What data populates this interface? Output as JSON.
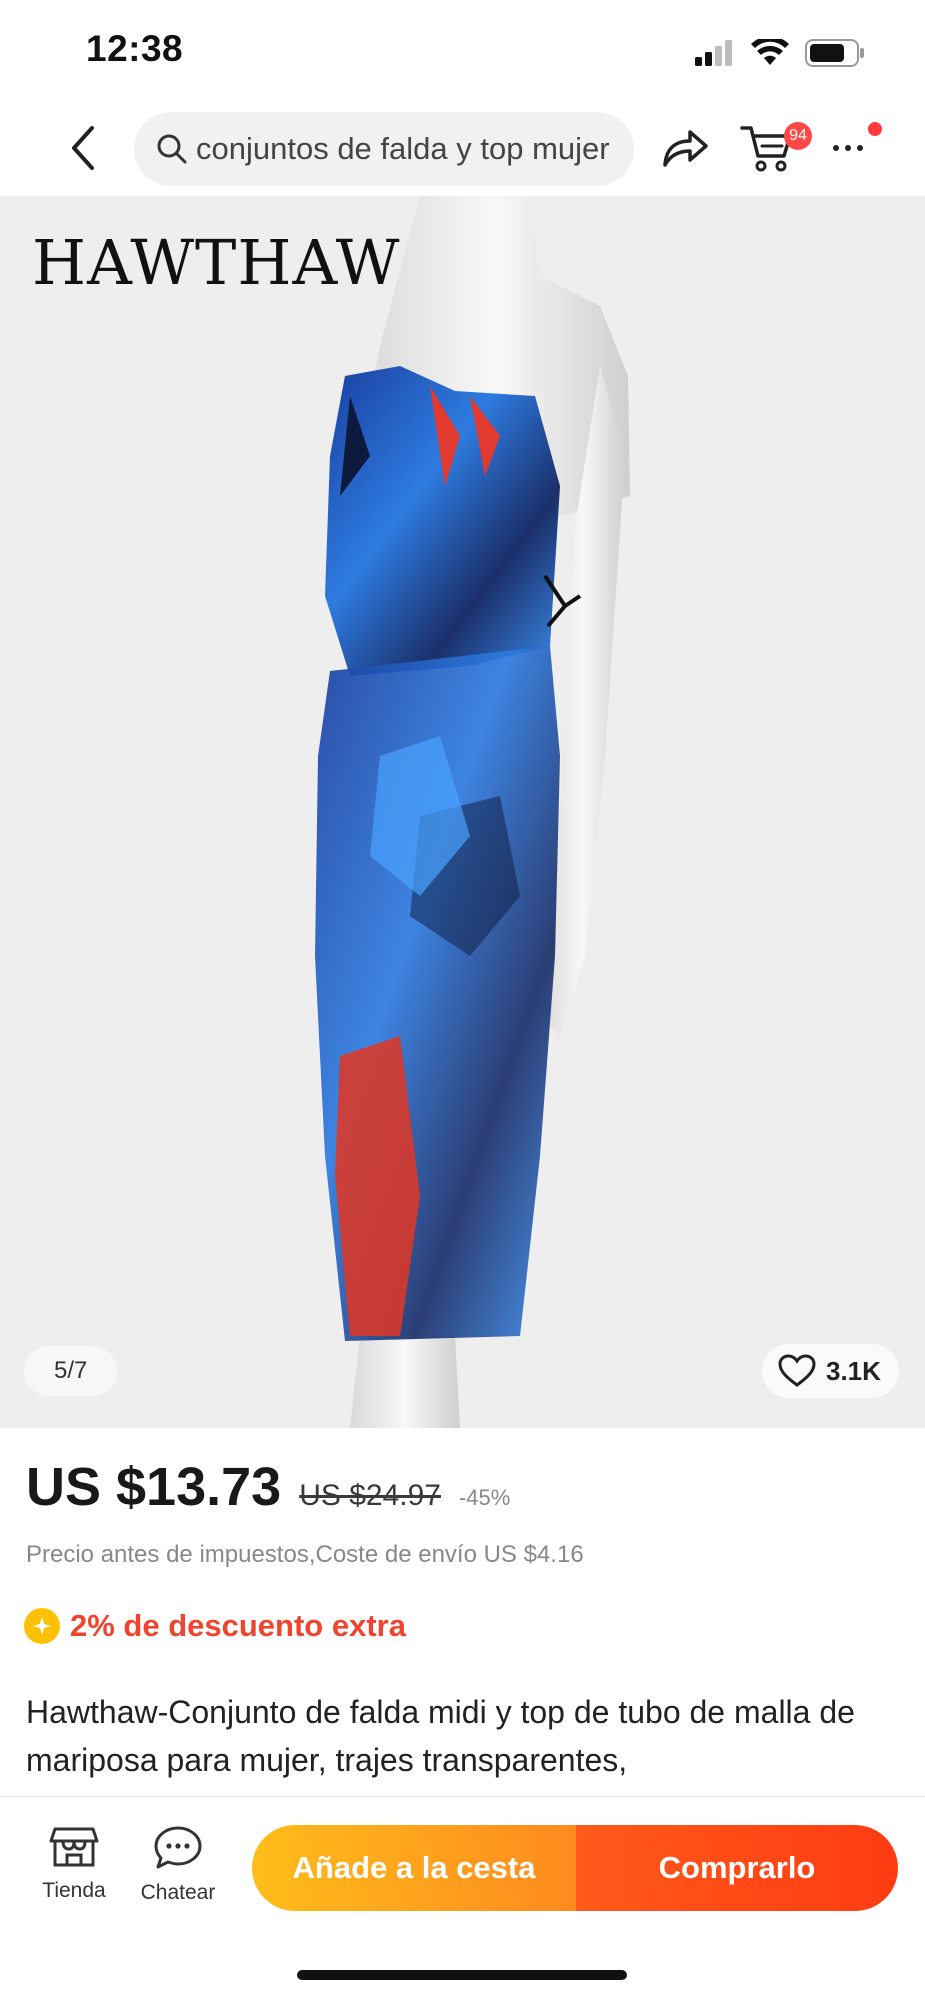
{
  "status_bar": {
    "time": "12:38",
    "icons": [
      "signal-icon",
      "wifi-icon",
      "battery-icon"
    ]
  },
  "nav": {
    "back_icon": "chevron-left-icon",
    "search_icon": "search-icon",
    "search_query": "conjuntos de falda y top mujer",
    "share_icon": "share-icon",
    "cart_icon": "cart-icon",
    "cart_count": "94",
    "more_icon": "more-icon"
  },
  "gallery": {
    "brand_logo": "HAWTHAW",
    "image_counter": "5/7",
    "wishlist_icon": "heart-icon",
    "wishlist_count": "3.1K"
  },
  "price": {
    "current": "US $13.73",
    "original": "US $24.97",
    "discount": "-45%",
    "tax_note": "Precio antes de impuestos,Coste de envío US $4.16"
  },
  "promo": {
    "icon": "coin-icon",
    "text": "2% de descuento extra"
  },
  "product": {
    "title": "Hawthaw-Conjunto de falda midi y top de tubo de malla de mariposa para mujer, trajes transparentes,"
  },
  "bottom_bar": {
    "store_label": "Tienda",
    "chat_label": "Chatear",
    "add_to_cart_label": "Añade a la cesta",
    "buy_now_label": "Comprarlo"
  },
  "colors": {
    "accent_red": "#f2432e",
    "cart_button": "#ffbd1a",
    "buy_button": "#ff4a12",
    "badge": "#ff4747"
  }
}
